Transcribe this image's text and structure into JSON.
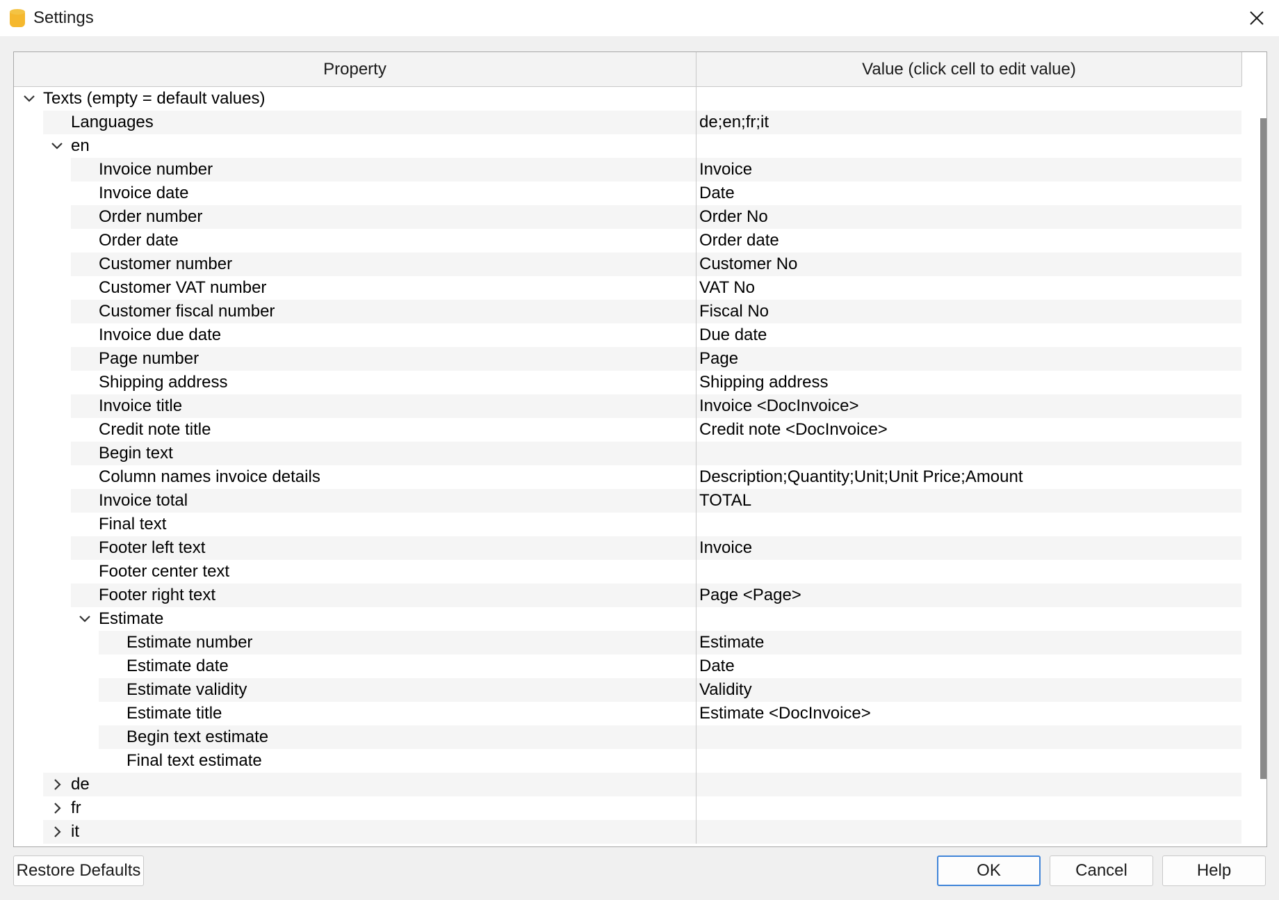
{
  "window": {
    "title": "Settings",
    "close_icon": "close-icon",
    "app_icon": "database-icon"
  },
  "grid": {
    "columns": [
      "Property",
      "Value (click cell to edit value)"
    ],
    "rows": [
      {
        "label": "Texts (empty = default values)",
        "value": "",
        "level": 0,
        "chevron": "expanded"
      },
      {
        "label": "Languages",
        "value": "de;en;fr;it",
        "level": 1,
        "chevron": "none"
      },
      {
        "label": "en",
        "value": "",
        "level": 1,
        "chevron": "expanded"
      },
      {
        "label": "Invoice number",
        "value": "Invoice",
        "level": 2,
        "chevron": "none"
      },
      {
        "label": "Invoice date",
        "value": "Date",
        "level": 2,
        "chevron": "none"
      },
      {
        "label": "Order number",
        "value": "Order No",
        "level": 2,
        "chevron": "none"
      },
      {
        "label": "Order date",
        "value": "Order date",
        "level": 2,
        "chevron": "none"
      },
      {
        "label": "Customer number",
        "value": "Customer No",
        "level": 2,
        "chevron": "none"
      },
      {
        "label": "Customer VAT number",
        "value": "VAT No",
        "level": 2,
        "chevron": "none"
      },
      {
        "label": "Customer fiscal number",
        "value": "Fiscal No",
        "level": 2,
        "chevron": "none"
      },
      {
        "label": "Invoice due date",
        "value": "Due date",
        "level": 2,
        "chevron": "none"
      },
      {
        "label": "Page number",
        "value": "Page",
        "level": 2,
        "chevron": "none"
      },
      {
        "label": "Shipping address",
        "value": "Shipping address",
        "level": 2,
        "chevron": "none"
      },
      {
        "label": "Invoice title",
        "value": "Invoice <DocInvoice>",
        "level": 2,
        "chevron": "none"
      },
      {
        "label": "Credit note title",
        "value": "Credit note <DocInvoice>",
        "level": 2,
        "chevron": "none"
      },
      {
        "label": "Begin text",
        "value": "",
        "level": 2,
        "chevron": "none"
      },
      {
        "label": "Column names invoice details",
        "value": "Description;Quantity;Unit;Unit Price;Amount",
        "level": 2,
        "chevron": "none"
      },
      {
        "label": "Invoice total",
        "value": "TOTAL",
        "level": 2,
        "chevron": "none"
      },
      {
        "label": "Final text",
        "value": "",
        "level": 2,
        "chevron": "none"
      },
      {
        "label": "Footer left text",
        "value": "Invoice",
        "level": 2,
        "chevron": "none"
      },
      {
        "label": "Footer center text",
        "value": "",
        "level": 2,
        "chevron": "none"
      },
      {
        "label": "Footer right text",
        "value": "Page <Page>",
        "level": 2,
        "chevron": "none"
      },
      {
        "label": "Estimate",
        "value": "",
        "level": 2,
        "chevron": "expanded"
      },
      {
        "label": "Estimate number",
        "value": "Estimate",
        "level": 3,
        "chevron": "none"
      },
      {
        "label": "Estimate date",
        "value": "Date",
        "level": 3,
        "chevron": "none"
      },
      {
        "label": "Estimate validity",
        "value": "Validity",
        "level": 3,
        "chevron": "none"
      },
      {
        "label": "Estimate title",
        "value": "Estimate <DocInvoice>",
        "level": 3,
        "chevron": "none"
      },
      {
        "label": "Begin text estimate",
        "value": "",
        "level": 3,
        "chevron": "none"
      },
      {
        "label": "Final text estimate",
        "value": "",
        "level": 3,
        "chevron": "none"
      },
      {
        "label": "de",
        "value": "",
        "level": 1,
        "chevron": "collapsed"
      },
      {
        "label": "fr",
        "value": "",
        "level": 1,
        "chevron": "collapsed"
      },
      {
        "label": "it",
        "value": "",
        "level": 1,
        "chevron": "collapsed"
      }
    ]
  },
  "buttons": {
    "restore_defaults": "Restore Defaults",
    "ok": "OK",
    "cancel": "Cancel",
    "help": "Help"
  },
  "colors": {
    "accent": "#3f84d8",
    "app_icon": "#f5b82e",
    "alt_row": "#f5f5f5",
    "scroll_thumb": "#8a8a8a"
  }
}
